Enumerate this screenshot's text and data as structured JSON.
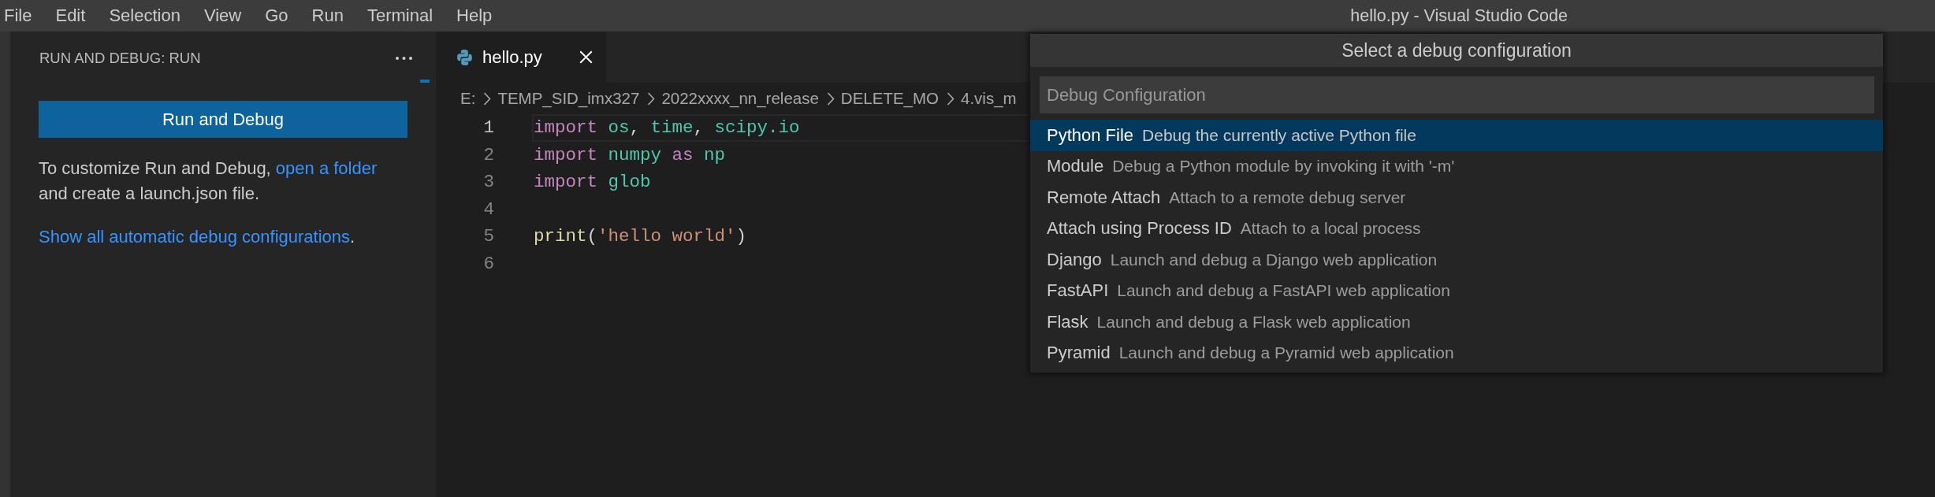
{
  "menu_bar": {
    "items": [
      "File",
      "Edit",
      "Selection",
      "View",
      "Go",
      "Run",
      "Terminal",
      "Help"
    ],
    "window_title": "hello.py - Visual Studio Code"
  },
  "sidebar": {
    "title": "RUN AND DEBUG: RUN",
    "button": "Run and Debug",
    "paragraphs": [
      {
        "before": "To customize Run and Debug, ",
        "link": "open a folder",
        "after": " and create a launch.json file."
      },
      {
        "link": "Show all automatic debug configurations",
        "after": "."
      }
    ]
  },
  "editor": {
    "tabs": [
      {
        "label": "hello.py",
        "selected": true
      }
    ],
    "breadcrumbs": [
      "E:",
      "TEMP_SID_imx327",
      "2022xxxx_nn_release",
      "DELETE_MO",
      "4.vis_m"
    ],
    "lines": [
      {
        "number": "1",
        "current": true,
        "tokens": [
          {
            "text": "import",
            "kind": "keyword"
          },
          {
            "text": " os",
            "kind": "module"
          },
          {
            "text": ", ",
            "kind": "punct"
          },
          {
            "text": "time",
            "kind": "module"
          },
          {
            "text": ", ",
            "kind": "punct"
          },
          {
            "text": "scipy.io",
            "kind": "module"
          }
        ]
      },
      {
        "number": "2",
        "current": false,
        "tokens": [
          {
            "text": "import",
            "kind": "keyword"
          },
          {
            "text": " numpy",
            "kind": "module"
          },
          {
            "text": " as",
            "kind": "keyword"
          },
          {
            "text": " np",
            "kind": "module"
          }
        ]
      },
      {
        "number": "3",
        "current": false,
        "tokens": [
          {
            "text": "import",
            "kind": "keyword"
          },
          {
            "text": " glob",
            "kind": "module"
          }
        ]
      },
      {
        "number": "4",
        "current": false
      },
      {
        "number": "5",
        "current": false,
        "tokens": [
          {
            "text": "print",
            "kind": "function"
          },
          {
            "text": "(",
            "kind": "punct"
          },
          {
            "text": "'hello world'",
            "kind": "string"
          },
          {
            "text": ")",
            "kind": "punct"
          }
        ]
      },
      {
        "number": "6",
        "current": false
      }
    ]
  },
  "quick_pick": {
    "title": "Select a debug configuration",
    "placeholder": "Debug Configuration",
    "items": [
      {
        "label": "Python File",
        "description": "Debug the currently active Python file",
        "selected": true
      },
      {
        "label": "Module",
        "description": "Debug a Python module by invoking it with '-m'",
        "selected": false
      },
      {
        "label": "Remote Attach",
        "description": "Attach to a remote debug server",
        "selected": false
      },
      {
        "label": "Attach using Process ID",
        "description": "Attach to a local process",
        "selected": false
      },
      {
        "label": "Django",
        "description": "Launch and debug a Django web application",
        "selected": false
      },
      {
        "label": "FastAPI",
        "description": "Launch and debug a FastAPI web application",
        "selected": false
      },
      {
        "label": "Flask",
        "description": "Launch and debug a Flask web application",
        "selected": false
      },
      {
        "label": "Pyramid",
        "description": "Launch and debug a Pyramid web application",
        "selected": false
      }
    ]
  }
}
